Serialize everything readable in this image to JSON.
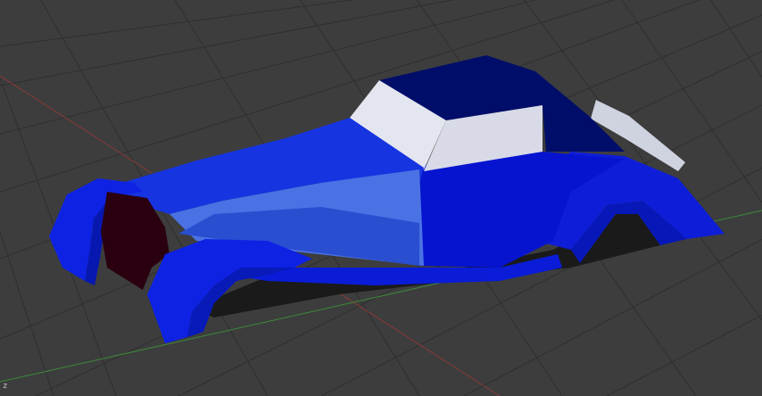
{
  "viewport": {
    "name": "3D Viewport",
    "model": "car-body",
    "axis_label": "z",
    "colors": {
      "background": "#3d3d3d",
      "grid_line": "#2f2f2f",
      "x_axis": "#8a3a3a",
      "y_axis": "#3f8a3a",
      "body_main": "#0a1ce6",
      "body_dark": "#00108a",
      "roof": "#000e6a",
      "hood_highlight": "#4a6ee0",
      "windows": "#d6d9e6",
      "grille": "#2a0010",
      "shadow": "#1a1a1a"
    }
  }
}
